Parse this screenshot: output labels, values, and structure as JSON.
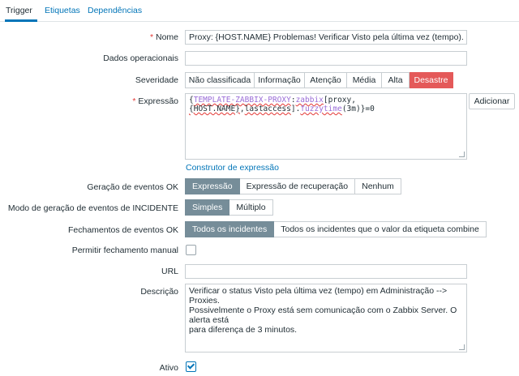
{
  "tabs": [
    {
      "label": "Trigger"
    },
    {
      "label": "Etiquetas"
    },
    {
      "label": "Dependências"
    }
  ],
  "form": {
    "name": {
      "required_mark": "*",
      "label": "Nome",
      "value": "Proxy: {HOST.NAME} Problemas! Verificar Visto pela última vez (tempo)."
    },
    "opdata": {
      "label": "Dados operacionais",
      "value": ""
    },
    "severity": {
      "label": "Severidade",
      "options": [
        "Não classificada",
        "Informação",
        "Atenção",
        "Média",
        "Alta",
        "Desastre"
      ],
      "selected": "Desastre",
      "selected_color": "#e45959"
    },
    "expression": {
      "required_mark": "*",
      "label": "Expressão",
      "value": "{TEMPLATE-ZABBIX-PROXY:zabbix[proxy,{HOST.NAME},lastaccess].fuzzytime(3m)}=0",
      "parts": {
        "open": "{",
        "template": "TEMPLATE-ZABBIX-PROXY",
        "colon": ":",
        "item": "zabbix",
        "bracket_open": "[proxy,",
        "host": "{HOST.NAME}",
        "comma": ",",
        "lastaccess": "lastaccess",
        "bracket_close": "]",
        "dot": ".",
        "func": "fuzzytime",
        "arg": "(3m)",
        "close": "}=0"
      },
      "add_button": "Adicionar",
      "builder_link": "Construtor de expressão"
    },
    "event_generation": {
      "label": "Geração de eventos OK",
      "options": [
        "Expressão",
        "Expressão de recuperação",
        "Nenhum"
      ],
      "selected": "Expressão"
    },
    "problem_mode": {
      "label": "Modo de geração de eventos de INCIDENTE",
      "options": [
        "Simples",
        "Múltiplo"
      ],
      "selected": "Simples"
    },
    "ok_close": {
      "label": "Fechamentos de eventos OK",
      "options": [
        "Todos os incidentes",
        "Todos os incidentes que o valor da etiqueta combine"
      ],
      "selected": "Todos os incidentes"
    },
    "manual_close": {
      "label": "Permitir fechamento manual",
      "checked": false
    },
    "url": {
      "label": "URL",
      "value": ""
    },
    "description": {
      "label": "Descrição",
      "lines": [
        "Verificar o status Visto pela última vez (tempo) em Administração --> Proxies.",
        "Possivelmente o Proxy está sem comunicação com o Zabbix Server. O alerta está",
        "para diferença de 3 minutos."
      ]
    },
    "enabled": {
      "label": "Ativo",
      "checked": true
    }
  },
  "colors": {
    "link": "#0275b8",
    "selected_toggle": "#768d99",
    "required": "#e33734",
    "disaster": "#e45959"
  }
}
